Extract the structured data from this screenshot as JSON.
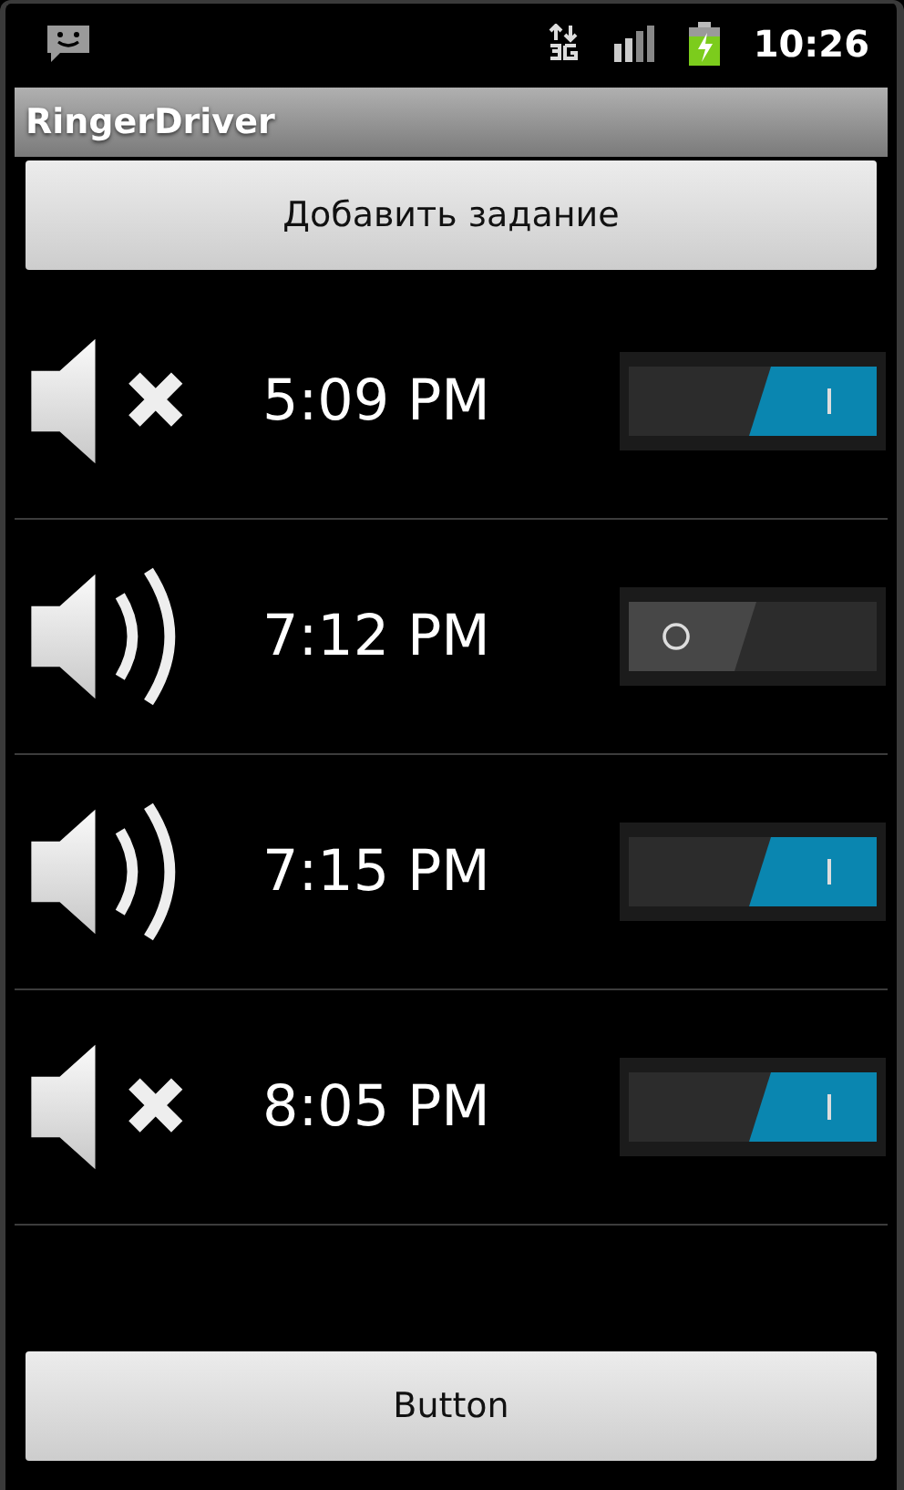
{
  "status_bar": {
    "time": "10:26"
  },
  "window": {
    "title": "RingerDriver"
  },
  "top_button": {
    "label": "Добавить задание"
  },
  "tasks": [
    {
      "muted": true,
      "time": "5:09 PM",
      "on": true
    },
    {
      "muted": false,
      "time": "7:12 PM",
      "on": false
    },
    {
      "muted": false,
      "time": "7:15 PM",
      "on": true
    },
    {
      "muted": true,
      "time": "8:05 PM",
      "on": true
    }
  ],
  "bottom_button": {
    "label": "Button"
  }
}
